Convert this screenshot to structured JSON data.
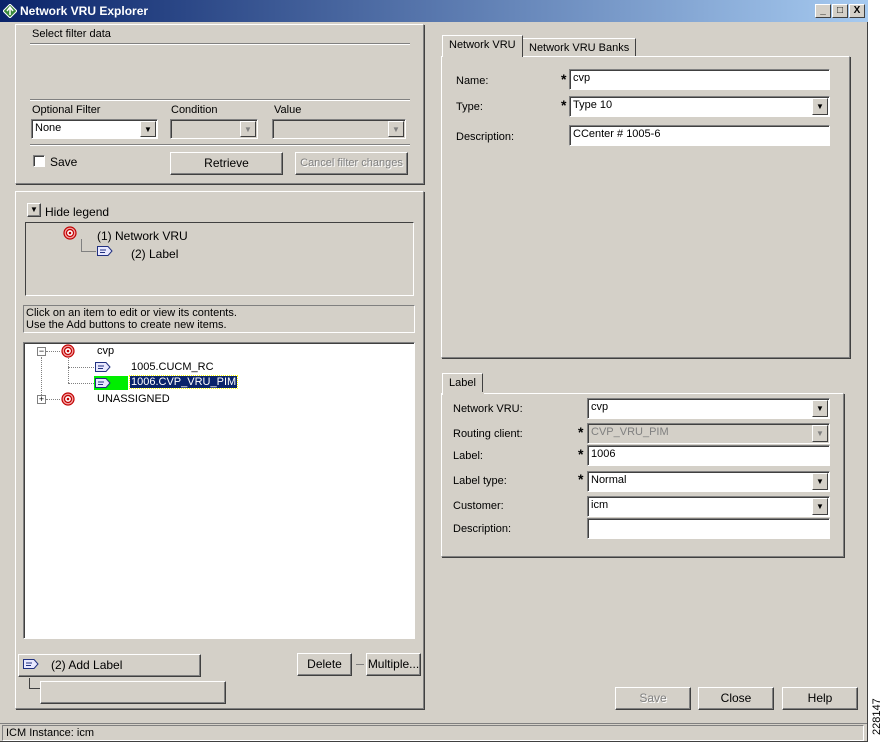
{
  "window": {
    "title": "Network VRU Explorer",
    "controls": [
      "_",
      "□",
      "X"
    ]
  },
  "filter": {
    "group_title": "Select filter data",
    "optional_filter_label": "Optional Filter",
    "condition_label": "Condition",
    "value_label": "Value",
    "optional_filter_value": "None",
    "condition_value": "",
    "value_value": "",
    "save_label": "Save",
    "retrieve_label": "Retrieve",
    "cancel_label": "Cancel filter changes"
  },
  "legend": {
    "toggle_label": "Hide legend",
    "item1": "(1) Network VRU",
    "item2": "(2) Label"
  },
  "instructions": {
    "line1": "Click on an item to edit or view its contents.",
    "line2": "Use the Add buttons to create new items."
  },
  "tree": {
    "root": "cvp",
    "children": [
      "1005.CUCM_RC",
      "1006.CVP_VRU_PIM"
    ],
    "unassigned": "UNASSIGNED"
  },
  "actions": {
    "add_label": "(2) Add Label",
    "delete_label": "Delete",
    "multiple_label": "Multiple..."
  },
  "vru_tabs": {
    "tab1": "Network VRU",
    "tab2": "Network VRU Banks"
  },
  "vru_form": {
    "name_label": "Name:",
    "name_value": "cvp",
    "type_label": "Type:",
    "type_value": "Type 10",
    "description_label": "Description:",
    "description_value": "CCenter # 1005-6",
    "required_marker": "*"
  },
  "label_tab": {
    "title": "Label"
  },
  "label_form": {
    "network_vru_label": "Network VRU:",
    "network_vru_value": "cvp",
    "routing_client_label": "Routing client:",
    "routing_client_value": "CVP_VRU_PIM",
    "label_label": "Label:",
    "label_value": "1006",
    "label_type_label": "Label type:",
    "label_type_value": "Normal",
    "customer_label": "Customer:",
    "customer_value": "icm",
    "description_label": "Description:",
    "description_value": ""
  },
  "footer": {
    "save_label": "Save",
    "close_label": "Close",
    "help_label": "Help"
  },
  "status": {
    "text": "ICM Instance: icm"
  },
  "figure_id": "228147"
}
